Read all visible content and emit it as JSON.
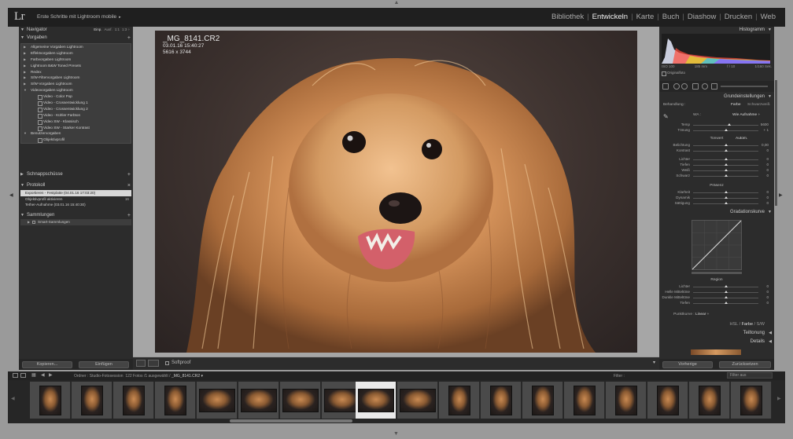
{
  "app": {
    "logo": "Lr",
    "catalog_title": "Erste Schritte mit Lightroom mobile",
    "catalog_arrow": "▸",
    "modules": [
      "Bibliothek",
      "Entwickeln",
      "Karte",
      "Buch",
      "Diashow",
      "Drucken",
      "Web"
    ],
    "active_module": "Entwickeln"
  },
  "navigator": {
    "title": "Navigator",
    "zoom_options": [
      "Einp.",
      "Ausf.",
      "1:1",
      "1:3 ÷"
    ]
  },
  "presets": {
    "title": "Vorgaben",
    "items": [
      {
        "label": "Allgemeine Vorgaben Lightroom",
        "type": "folder"
      },
      {
        "label": "Effektvorgaben Lightroom",
        "type": "folder"
      },
      {
        "label": "Farbvorgaben Lightroom",
        "type": "folder"
      },
      {
        "label": "Lightroom B&W Toned Presets",
        "type": "folder"
      },
      {
        "label": "Redex",
        "type": "folder"
      },
      {
        "label": "S/W-Filtervorgaben Lightroom",
        "type": "folder"
      },
      {
        "label": "S/W-Vorgaben Lightroom",
        "type": "folder"
      },
      {
        "label": "Videovorgaben Lightroom",
        "type": "open"
      },
      {
        "label": "Video - Color Pop",
        "type": "child"
      },
      {
        "label": "Video - Crossentwicklung 1",
        "type": "child"
      },
      {
        "label": "Video - Crossentwicklung 2",
        "type": "child"
      },
      {
        "label": "Video - Kühler Farbton",
        "type": "child"
      },
      {
        "label": "Video SW - Klassisch",
        "type": "child"
      },
      {
        "label": "Video SW - Starker Kontrast",
        "type": "child"
      },
      {
        "label": "Benutzervorgaben",
        "type": "open"
      },
      {
        "label": "Objektivprofil",
        "type": "child"
      }
    ]
  },
  "snapshots": {
    "title": "Schnappschüsse"
  },
  "history": {
    "title": "Protokoll",
    "items": [
      {
        "label": "Exportieren - Festplatte (04.01.16 17:03:20)",
        "num": "",
        "selected": true
      },
      {
        "label": "Objektivprofil aktivieren",
        "num": "16",
        "selected": false
      },
      {
        "label": "Tether-Aufnahme (03.01.16 15:40:30)",
        "num": "",
        "selected": false
      }
    ]
  },
  "collections": {
    "title": "Sammlungen",
    "items": [
      {
        "label": "Smart-Sammlungen"
      }
    ]
  },
  "left_buttons": {
    "copy": "Kopieren...",
    "paste": "Einfügen"
  },
  "photo": {
    "filename": "_MG_8141.CR2",
    "datetime": "03.01.16 15:40:27",
    "dimensions": "5616 x 3744"
  },
  "toolbar": {
    "softproof": "Softproof",
    "dropdown": "▾"
  },
  "histogram": {
    "title": "Histogramm",
    "iso": "ISO 100",
    "focal": "185 mm",
    "aperture": "f / 10",
    "shutter": "1/160 Sek.",
    "original_photo": "Originalfoto"
  },
  "basic": {
    "title": "Grundeinstellungen",
    "treatment_label": "Behandlung :",
    "treatment_color": "Farbe",
    "treatment_bw": "Schwarzweiß",
    "wb_label": "WA :",
    "wb_value": "Wie Aufnahme ÷",
    "temp": {
      "name": "Temp",
      "value": "5600"
    },
    "tint": {
      "name": "Tönung",
      "value": "+ 1"
    },
    "tone_label": "Tonwert",
    "auto_label": "Autom.",
    "tone_sliders": [
      {
        "name": "Belichtung",
        "value": "0,00"
      },
      {
        "name": "Kontrast",
        "value": "0"
      },
      {
        "name": "Lichter",
        "value": "0"
      },
      {
        "name": "Tiefen",
        "value": "0"
      },
      {
        "name": "Weiß",
        "value": "0"
      },
      {
        "name": "Schwarz",
        "value": "0"
      }
    ],
    "presence_label": "Präsenz",
    "presence_sliders": [
      {
        "name": "Klarheit",
        "value": "0"
      },
      {
        "name": "Dynamik",
        "value": "0"
      },
      {
        "name": "Sättigung",
        "value": "0"
      }
    ]
  },
  "tone_curve": {
    "title": "Gradationskurve",
    "region_label": "Region",
    "sliders": [
      {
        "name": "Lichter",
        "value": "0"
      },
      {
        "name": "Helle Mitteltöne",
        "value": "0"
      },
      {
        "name": "Dunkle Mitteltöne",
        "value": "0"
      },
      {
        "name": "Tiefen",
        "value": "0"
      }
    ],
    "point_curve_label": "Punktkurve :",
    "point_curve_value": "Linear ÷"
  },
  "hsl": {
    "hsl": "HSL",
    "color": "Farbe",
    "bw": "S/W"
  },
  "split_toning": {
    "title": "Teiltonung"
  },
  "details": {
    "title": "Details"
  },
  "right_buttons": {
    "previous": "Vorherige",
    "reset": "Zurücksetzen"
  },
  "filmstrip": {
    "source": "Ordner : Studio-Fotosession",
    "count": "122 Fotos /1 ausgewählt /",
    "selected_file": "_MG_8141.CR2 ▾",
    "filter_label": "Filter :",
    "filter_value": "Filter aus"
  },
  "colors": {
    "panel": "#2c2c2c",
    "background": "#a6a6a6",
    "topbar": "#1f1f1f",
    "active_text": "#f0f0f0",
    "selection": "#d8d8d8"
  }
}
